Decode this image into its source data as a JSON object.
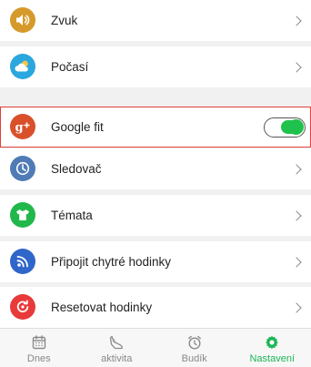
{
  "settings": {
    "items": [
      {
        "label": "Zvuk",
        "icon": "speaker-icon",
        "color": "#d69a2a",
        "control": "chevron"
      },
      {
        "label": "Počasí",
        "icon": "weather-icon",
        "color": "#2aa7de",
        "control": "chevron"
      },
      {
        "label": "Google fit",
        "icon": "google-plus-icon",
        "color": "#d9502b",
        "control": "toggle",
        "toggle_on": true
      },
      {
        "label": "Sledovač",
        "icon": "clock-icon",
        "color": "#4f7bb6",
        "control": "chevron"
      },
      {
        "label": "Témata",
        "icon": "tshirt-icon",
        "color": "#20b84a",
        "control": "chevron"
      },
      {
        "label": "Připojit chytré hodinky",
        "icon": "rss-icon",
        "color": "#2f66c9",
        "control": "chevron"
      },
      {
        "label": "Resetovat hodinky",
        "icon": "reset-icon",
        "color": "#e83a3a",
        "control": "chevron"
      }
    ]
  },
  "tabbar": {
    "tabs": [
      {
        "label": "Dnes",
        "icon": "calendar-icon",
        "active": false
      },
      {
        "label": "aktivita",
        "icon": "shoe-icon",
        "active": false
      },
      {
        "label": "Budík",
        "icon": "alarm-clock-icon",
        "active": false
      },
      {
        "label": "Nastavení",
        "icon": "gear-icon",
        "active": true
      }
    ],
    "active_color": "#1bb555",
    "inactive_color": "#888888"
  },
  "colors": {
    "highlight_border": "#e0403a",
    "toggle_on": "#1ec24c"
  }
}
